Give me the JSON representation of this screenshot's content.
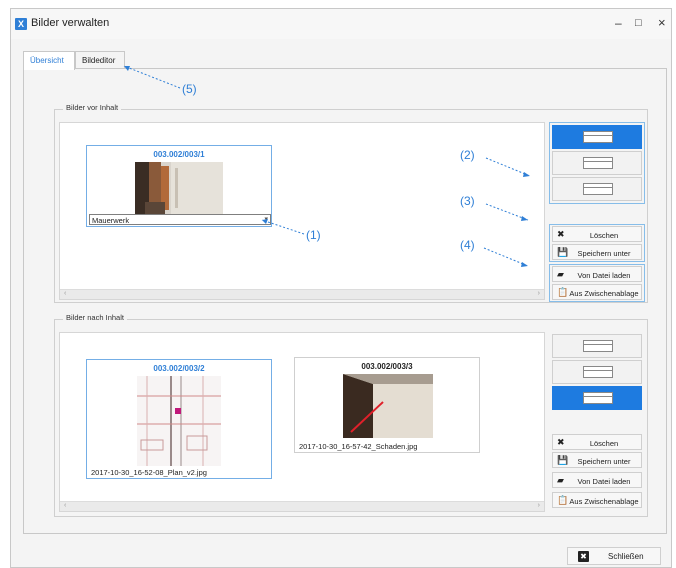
{
  "window": {
    "title": "Bilder verwalten",
    "app_icon": "X",
    "minimize": "–",
    "maximize": "□",
    "close": "×"
  },
  "tabs": [
    {
      "label": "Übersicht",
      "active": true
    },
    {
      "label": "Bildeditor",
      "active": false
    }
  ],
  "groups": {
    "before": {
      "label": "Bilder vor Inhalt",
      "cards": [
        {
          "title": "003.002/003/1",
          "caption": "Mauerwerk",
          "editing": true,
          "selected": true
        }
      ],
      "layout_options": [
        "layout-option-1",
        "layout-option-2",
        "layout-option-3"
      ],
      "active_layout": 0
    },
    "after": {
      "label": "Bilder nach Inhalt",
      "cards": [
        {
          "title": "003.002/003/2",
          "caption": "2017-10-30_16-52-08_Plan_v2.jpg",
          "selected": true
        },
        {
          "title": "003.002/003/3",
          "caption": "2017-10-30_16-57-42_Schaden.jpg",
          "selected": false
        }
      ],
      "layout_options": [
        "layout-option-1",
        "layout-option-2",
        "layout-option-3"
      ],
      "active_layout": 2
    }
  },
  "actions": {
    "delete": "Löschen",
    "save_as": "Speichern unter",
    "load_file": "Von Datei laden",
    "from_clipboard": "Aus Zwischenablage"
  },
  "icons": {
    "delete": "close-icon",
    "save": "floppy-disk-icon",
    "load": "folder-open-icon",
    "clipboard": "clipboard-icon"
  },
  "scroll": {
    "left": "‹",
    "right": "›"
  },
  "annotations": [
    "(1)",
    "(2)",
    "(3)",
    "(4)",
    "(5)"
  ],
  "footer": {
    "close_label": "Schließen"
  },
  "colors": {
    "accent": "#2f7fd6",
    "active_layout": "#1e7be0",
    "annotation": "#2f7fd6"
  }
}
